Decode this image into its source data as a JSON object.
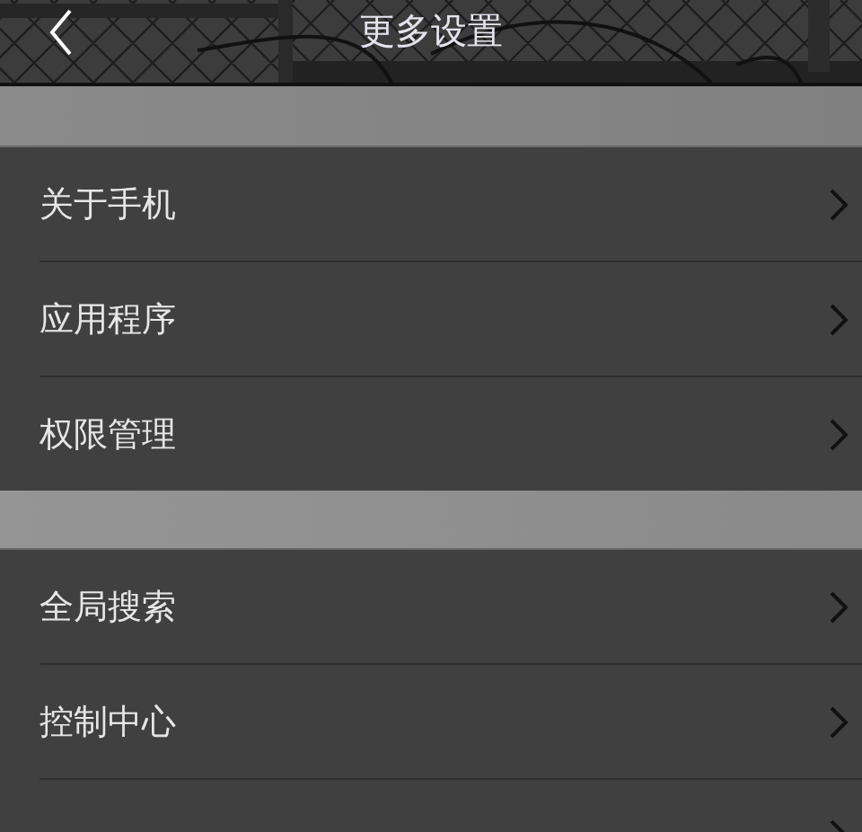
{
  "header": {
    "title": "更多设置"
  },
  "groups": [
    {
      "items": [
        {
          "label": "关于手机"
        },
        {
          "label": "应用程序"
        },
        {
          "label": "权限管理"
        }
      ]
    },
    {
      "items": [
        {
          "label": "全局搜索"
        },
        {
          "label": "控制中心"
        }
      ],
      "continues_below": true
    }
  ]
}
